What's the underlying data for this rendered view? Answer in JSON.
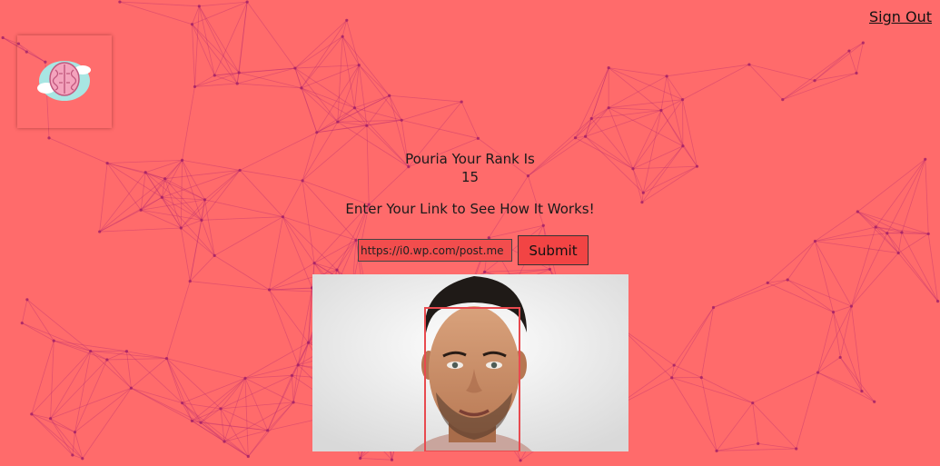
{
  "header": {
    "signout_label": "Sign Out"
  },
  "logo": {
    "icon": "brain-cloud-icon"
  },
  "rank": {
    "label": "Pouria Your Rank Is",
    "value": "15"
  },
  "instruction": "Enter Your Link to See How It Works!",
  "form": {
    "url_value": "https://i0.wp.com/post.me",
    "submit_label": "Submit"
  },
  "colors": {
    "background": "#ff6b6b",
    "network_lines": "#b5286f",
    "input_bg": "#f24d4d",
    "button_bg": "#f24444",
    "face_box": "#e84a4f"
  }
}
